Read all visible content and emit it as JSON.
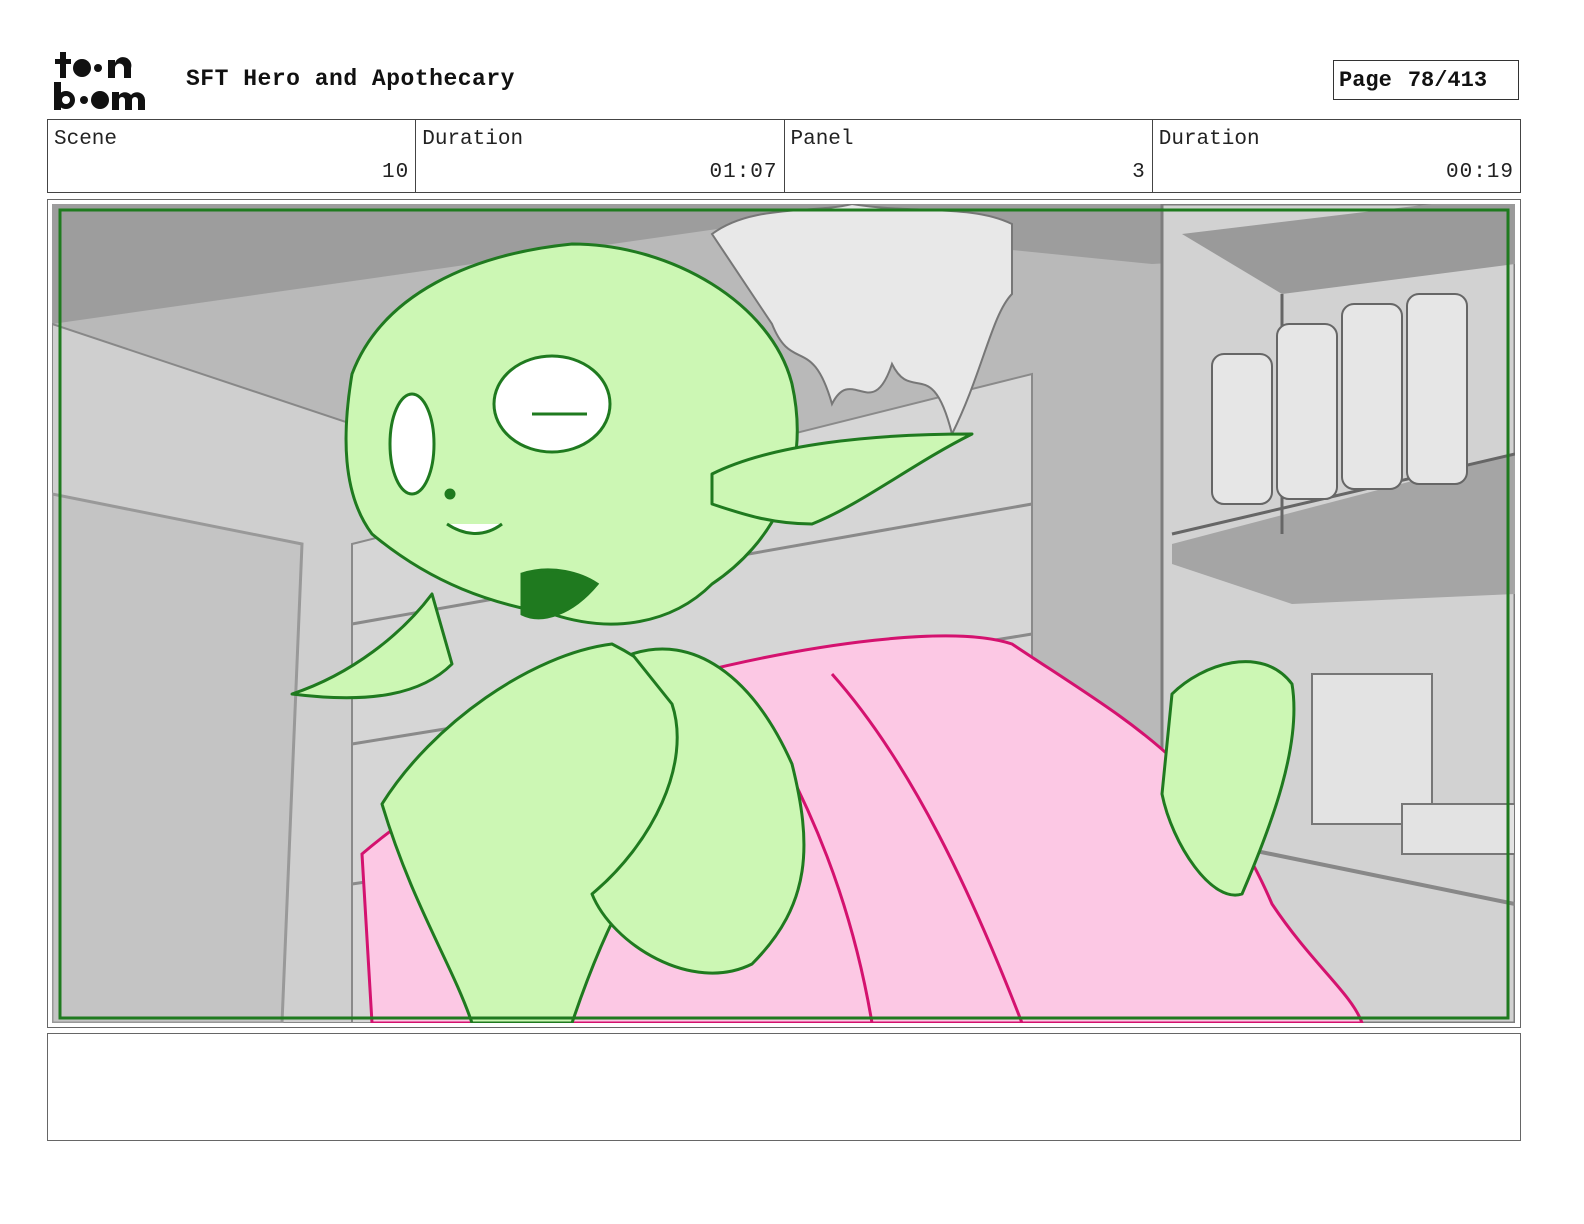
{
  "header": {
    "logo_alt": "toon boom",
    "project_title": "SFT Hero and Apothecary",
    "page_label": "Page",
    "page_number": "78/413"
  },
  "info": [
    {
      "label": "Scene",
      "value": "10"
    },
    {
      "label": "Duration",
      "value": "01:07"
    },
    {
      "label": "Panel",
      "value": "3"
    },
    {
      "label": "Duration",
      "value": "00:19"
    }
  ],
  "panel": {
    "description": "",
    "colors": {
      "background": "#a9a9a9",
      "character_fill": "#ccf7b4",
      "character_line": "#1f7a1f",
      "garment_fill": "#fcc8e4",
      "garment_line": "#d4126f",
      "frame_line": "#1f7a1f"
    }
  },
  "notes": {
    "text": ""
  }
}
